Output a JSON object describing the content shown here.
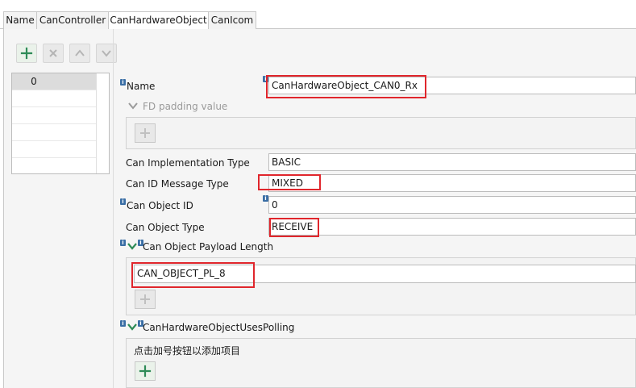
{
  "tabs": [
    "Name",
    "CanController",
    "CanHardwareObject",
    "CanIcom"
  ],
  "list": {
    "items": [
      "0"
    ]
  },
  "fields": {
    "name_label": "Name",
    "name_value": "CanHardwareObject_CAN0_Rx",
    "fd_padding_label": "FD padding value",
    "impl_type_label": "Can Implementation Type",
    "impl_type_value": "BASIC",
    "id_msg_type_label": "Can ID Message Type",
    "id_msg_type_value": "MIXED",
    "object_id_label": "Can Object ID",
    "object_id_value": "0",
    "object_type_label": "Can Object Type",
    "object_type_value": "RECEIVE",
    "payload_label": "Can Object Payload Length",
    "payload_value": "CAN_OBJECT_PL_8",
    "polling_label": "CanHardwareObjectUsesPolling",
    "polling_hint": "点击加号按钮以添加项目"
  },
  "badges": {
    "info": "i"
  },
  "icons": {
    "add": "plus-icon",
    "remove": "x-icon",
    "up": "chevron-up-icon",
    "down": "chevron-down-icon",
    "expand": "chevron-down-icon",
    "info": "info-icon"
  },
  "colors": {
    "accent_green": "#2e8b57",
    "highlight_red": "#e0262c",
    "info_blue": "#3a6ea5"
  }
}
